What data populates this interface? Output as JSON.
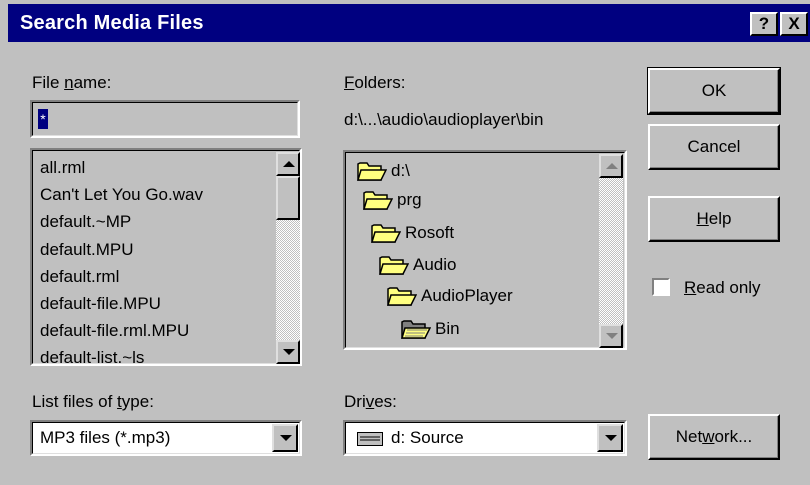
{
  "window": {
    "title": "Search Media Files",
    "help_glyph": "?",
    "close_glyph": "X"
  },
  "file_name": {
    "label_pre": "File ",
    "label_key": "n",
    "label_post": "ame:",
    "value": "*"
  },
  "files_list": {
    "items": [
      "all.rml",
      "Can't Let You Go.wav",
      "default.~MP",
      "default.MPU",
      "default.rml",
      "default-file.MPU",
      "default-file.rml.MPU",
      "default-list.~ls"
    ]
  },
  "folders": {
    "label_key": "F",
    "label_post": "olders:",
    "current_path": "d:\\...\\audio\\audioplayer\\bin",
    "tree": [
      {
        "label": "d:\\",
        "icon": "open-folder-icon"
      },
      {
        "label": "prg",
        "icon": "open-folder-icon"
      },
      {
        "label": "Rosoft",
        "icon": "open-folder-icon"
      },
      {
        "label": "Audio",
        "icon": "open-folder-icon"
      },
      {
        "label": "AudioPlayer",
        "icon": "open-folder-icon"
      },
      {
        "label": "Bin",
        "icon": "open-folder-selected-icon"
      }
    ]
  },
  "file_type": {
    "label_pre": "List files of ",
    "label_key": "t",
    "label_post": "ype:",
    "selected": "MP3 files (*.mp3)"
  },
  "drives": {
    "label_pre": "Dri",
    "label_key": "v",
    "label_post": "es:",
    "selected": "d: Source",
    "icon": "drive-icon"
  },
  "buttons": {
    "ok": "OK",
    "cancel": "Cancel",
    "help_key": "H",
    "help_post": "elp",
    "network_pre": "Net",
    "network_key": "w",
    "network_post": "ork..."
  },
  "read_only": {
    "label_key": "R",
    "label_post": "ead only",
    "checked": false
  },
  "colors": {
    "title_bar": "#000080",
    "dialog_bg": "#c0c0c0",
    "folder_fill": "#ffff80"
  }
}
